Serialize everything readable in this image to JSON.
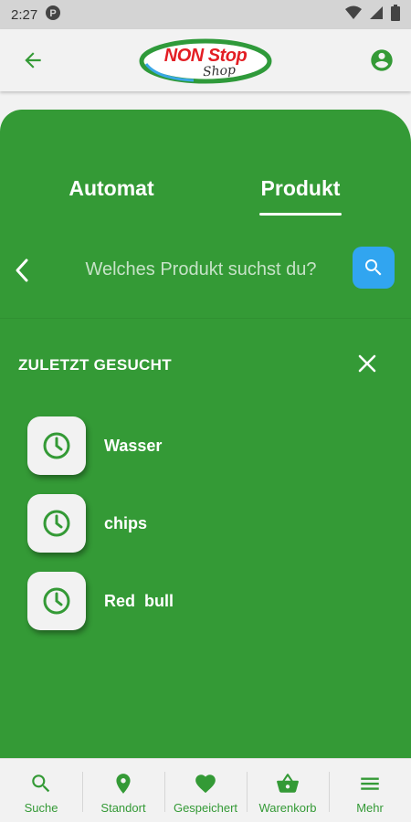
{
  "status_bar": {
    "time": "2:27"
  },
  "app_bar": {
    "logo_main": "NON Stop",
    "logo_sub": "Shop"
  },
  "tabs": [
    {
      "label": "Automat",
      "active": false
    },
    {
      "label": "Produkt",
      "active": true
    }
  ],
  "search": {
    "placeholder": "Welches Produkt suchst du?"
  },
  "recent": {
    "title": "ZULETZT GESUCHT",
    "items": [
      {
        "label": "Wasser",
        "icon": "clock-icon"
      },
      {
        "label": "chips",
        "icon": "clock-icon"
      },
      {
        "label": "Red  bull",
        "icon": "clock-icon"
      }
    ]
  },
  "bottom_nav": [
    {
      "label": "Suche",
      "icon": "search-icon"
    },
    {
      "label": "Standort",
      "icon": "location-pin-icon"
    },
    {
      "label": "Gespeichert",
      "icon": "heart-icon"
    },
    {
      "label": "Warenkorb",
      "icon": "basket-icon"
    },
    {
      "label": "Mehr",
      "icon": "menu-icon"
    }
  ],
  "colors": {
    "primary_green": "#349a36",
    "search_button_blue": "#31a5f0",
    "logo_red": "#e31e24",
    "logo_ring_green": "#2f9a3a",
    "logo_ring_blue": "#3aa7e6"
  }
}
